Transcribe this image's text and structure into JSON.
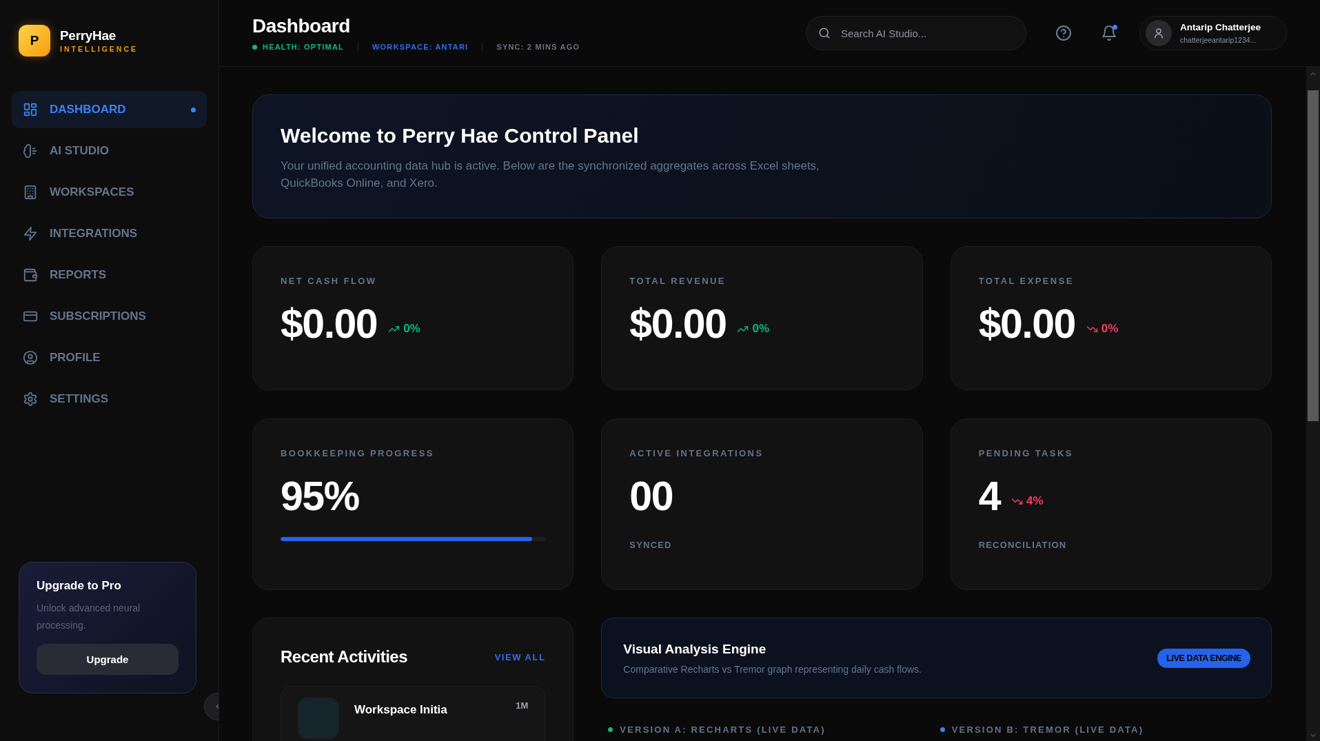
{
  "brand": {
    "logo_letter": "P",
    "name": "PerryHae",
    "tagline": "INTELLIGENCE"
  },
  "nav": [
    {
      "label": "DASHBOARD",
      "selected": true
    },
    {
      "label": "AI STUDIO",
      "selected": false
    },
    {
      "label": "WORKSPACES",
      "selected": false
    },
    {
      "label": "INTEGRATIONS",
      "selected": false
    },
    {
      "label": "REPORTS",
      "selected": false
    },
    {
      "label": "SUBSCRIPTIONS",
      "selected": false
    },
    {
      "label": "PROFILE",
      "selected": false
    },
    {
      "label": "SETTINGS",
      "selected": false
    }
  ],
  "upgrade": {
    "title": "Upgrade to Pro",
    "text": "Unlock advanced neural processing.",
    "button": "Upgrade"
  },
  "header": {
    "title": "Dashboard",
    "status": [
      {
        "label": "HEALTH: OPTIMAL",
        "color": "#10b981",
        "dot": true
      },
      {
        "label": "WORKSPACE: ANTARI",
        "color": "#2f6fe8",
        "dot": false
      },
      {
        "label": "SYNC: 2 MINS AGO",
        "color": "#6b7280",
        "dot": false
      }
    ],
    "search": {
      "placeholder": "Search AI Studio..."
    },
    "notifications": {
      "unread": true
    },
    "user": {
      "name": "Antarip Chatterjee",
      "email": "chatterjeeantarip1234..."
    }
  },
  "welcome": {
    "title": "Welcome to Perry Hae Control Panel",
    "text": "Your unified accounting data hub is active. Below are the synchronized aggregates across Excel sheets, QuickBooks Online, and Xero."
  },
  "stats": [
    {
      "kind": "trend",
      "label": "NET CASH FLOW",
      "value": "$0.00",
      "change": "0%",
      "rising": true
    },
    {
      "kind": "trend",
      "label": "TOTAL REVENUE",
      "value": "$0.00",
      "change": "0%",
      "rising": true
    },
    {
      "kind": "trend",
      "label": "TOTAL EXPENSE",
      "value": "$0.00",
      "change": "0%",
      "rising": false
    },
    {
      "kind": "progress",
      "label": "BOOKKEEPING PROGRESS",
      "value": "95%",
      "level": 0.95
    },
    {
      "kind": "count",
      "label": "ACTIVE INTEGRATIONS",
      "value": "00",
      "caption": "SYNCED"
    },
    {
      "kind": "trend",
      "label": "PENDING TASKS",
      "value": "4",
      "change": "4%",
      "rising": false,
      "caption": "RECONCILIATION"
    }
  ],
  "activities": {
    "title": "Recent Activities",
    "link": "VIEW ALL",
    "items": [
      {
        "title": "Workspace Initia",
        "time": "1M"
      }
    ]
  },
  "engine": {
    "title": "Visual Analysis Engine",
    "subtitle": "Comparative Recharts vs Tremor graph representing daily cash flows.",
    "badge": "LIVE DATA ENGINE"
  },
  "versions": [
    {
      "label": "VERSION A: RECHARTS (LIVE DATA)",
      "color": "#10b981"
    },
    {
      "label": "VERSION B: TREMOR (LIVE DATA)",
      "color": "#3b82f6"
    }
  ]
}
